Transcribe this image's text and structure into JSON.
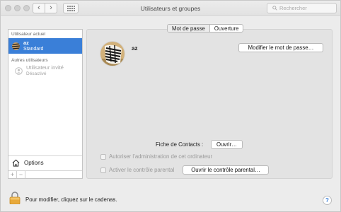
{
  "window": {
    "title": "Utilisateurs et groupes"
  },
  "toolbar": {
    "back": "‹",
    "forward": "›",
    "search_placeholder": "Rechercher"
  },
  "sidebar": {
    "current_header": "Utilisateur actuel",
    "current_user": {
      "name": "az",
      "role": "Standard"
    },
    "others_header": "Autres utilisateurs",
    "guest_user": {
      "name": "Utilisateur invité",
      "status": "Désactivé"
    },
    "options_label": "Options",
    "add": "+",
    "remove": "−"
  },
  "tabs": [
    {
      "label": "Mot de passe"
    },
    {
      "label": "Ouverture"
    }
  ],
  "user": {
    "name": "az"
  },
  "buttons": {
    "change_password": "Modifier le mot de passe…",
    "open_contact": "Ouvrir…",
    "open_parental": "Ouvrir le contrôle parental…"
  },
  "contact_card_label": "Fiche de Contacts :",
  "checkboxes": {
    "admin": "Autoriser l’administration de cet ordinateur",
    "parental": "Activer le contrôle parental"
  },
  "footer": {
    "lock_text": "Pour modifier, cliquez sur le cadenas.",
    "help": "?"
  },
  "colors": {
    "selection": "#3a7fd8",
    "window_bg": "#ececec",
    "panel_bg": "#e3e3e3"
  }
}
